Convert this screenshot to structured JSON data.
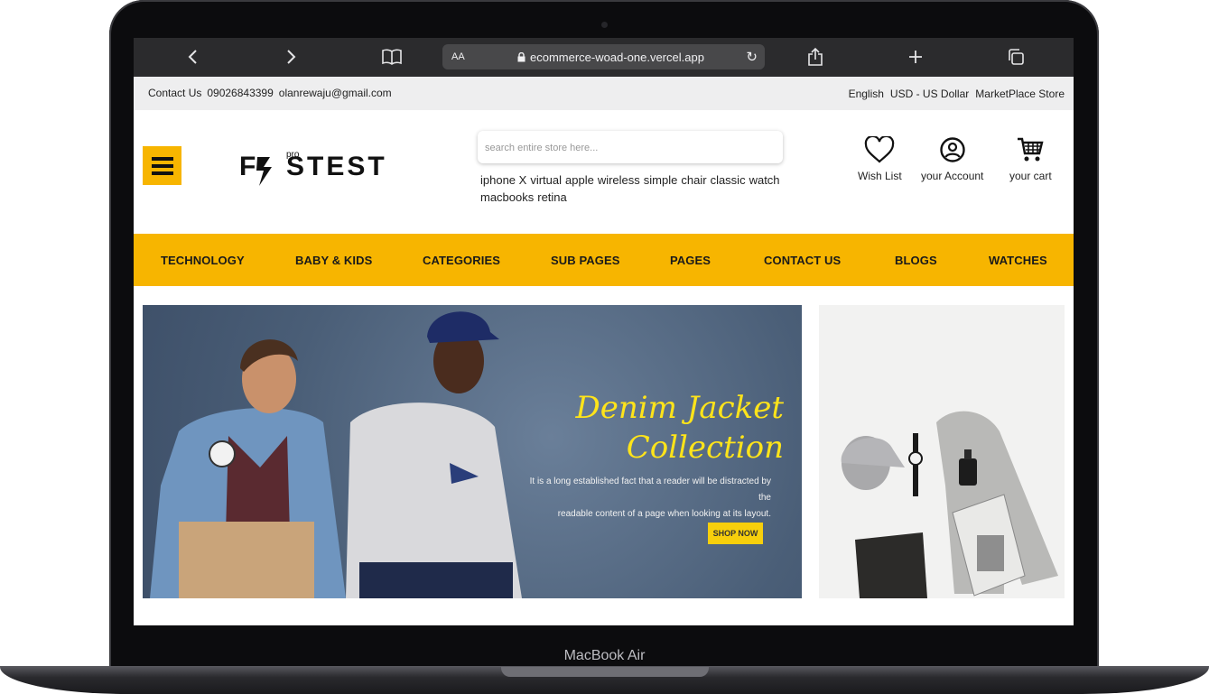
{
  "device": {
    "model_label": "MacBook Air"
  },
  "browser": {
    "text_size_label": "AA",
    "url": "ecommerce-woad-one.vercel.app",
    "icons": [
      "back-icon",
      "forward-icon",
      "bookmarks-icon",
      "lock-icon",
      "reload-icon",
      "share-icon",
      "new-tab-icon",
      "tabs-icon"
    ]
  },
  "topbar": {
    "contact_label": "Contact Us",
    "phone": "09026843399",
    "email": "olanrewaju@gmail.com",
    "language": "English",
    "currency": "USD - US Dollar",
    "store": "MarketPlace Store"
  },
  "header": {
    "logo_text": "F STEST",
    "logo_sup": "pro",
    "search_placeholder": "search entire store here...",
    "search_tags": [
      "iphone X",
      "virtual",
      "apple",
      "wireless",
      "simple",
      "chair",
      "classic",
      "watch",
      "macbooks",
      "retina"
    ],
    "wishlist_label": "Wish List",
    "account_label": "your Account",
    "cart_label": "your cart"
  },
  "nav": {
    "items": [
      "TECHNOLOGY",
      "BABY & KIDS",
      "CATEGORIES",
      "SUB PAGES",
      "PAGES",
      "CONTACT US",
      "BLOGS",
      "WATCHES"
    ]
  },
  "hero": {
    "title_line1": "Denim Jacket",
    "title_line2": "Collection",
    "text_line1": "It is a long established fact that a reader will be distracted  by the",
    "text_line2": "readable content of a page when looking at its layout.",
    "button_label": "SHOP NOW"
  },
  "colors": {
    "accent": "#f7b500",
    "hero_title": "#ffe41a",
    "button": "#f7cf0c"
  }
}
